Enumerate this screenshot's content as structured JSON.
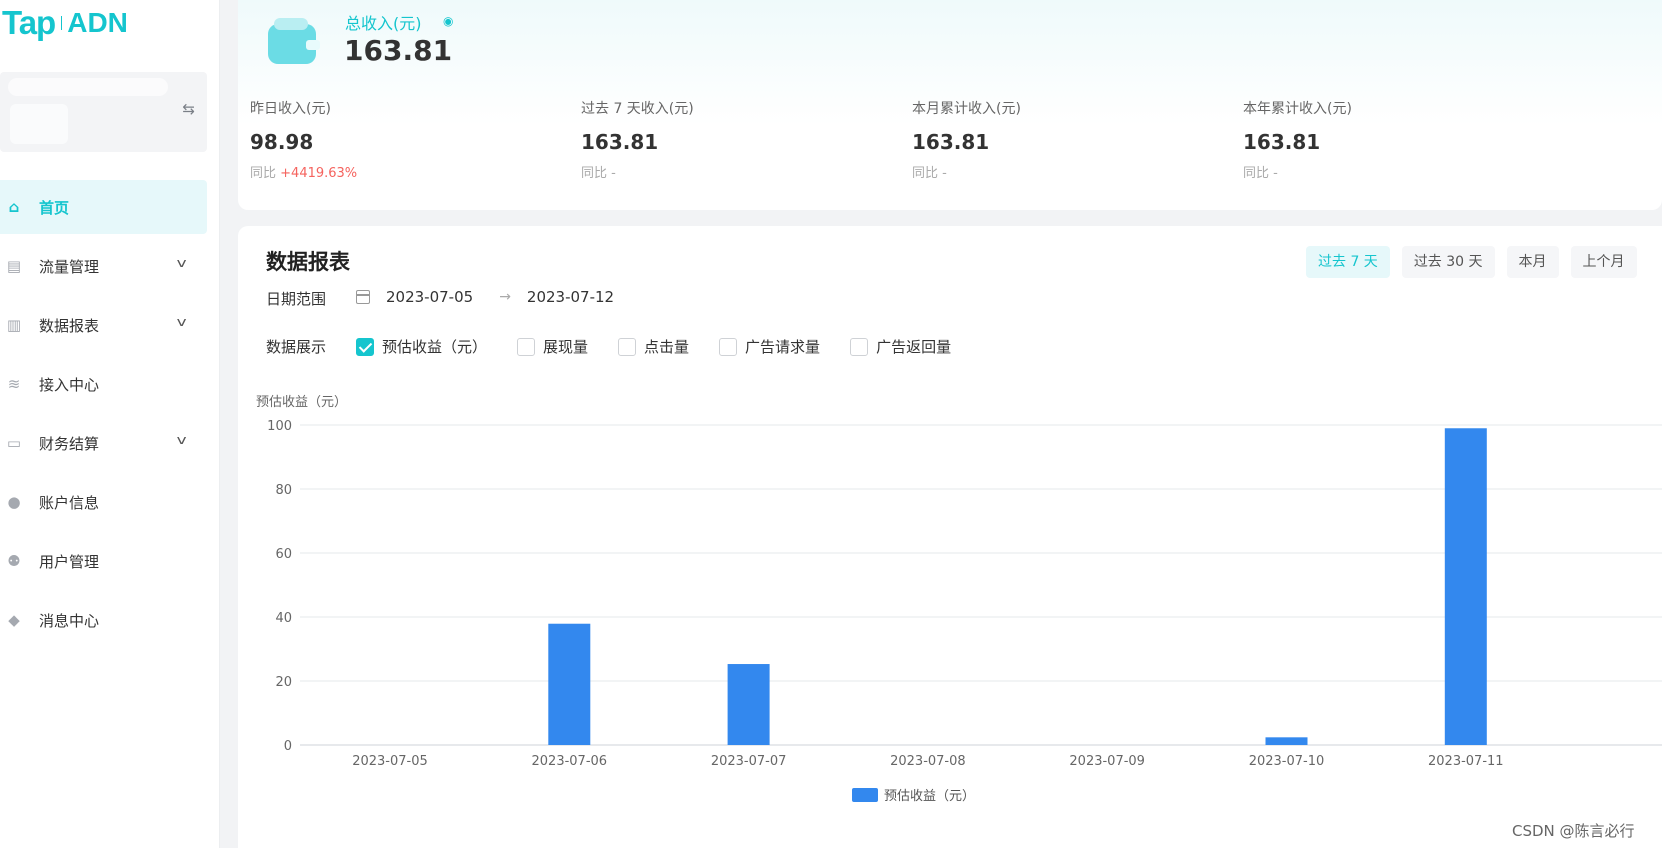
{
  "brand": {
    "tap": "Tap",
    "adn": "ADN"
  },
  "nav": [
    {
      "label": "首页",
      "icon": "home-icon",
      "active": true,
      "expandable": false
    },
    {
      "label": "流量管理",
      "icon": "traffic-icon",
      "active": false,
      "expandable": true
    },
    {
      "label": "数据报表",
      "icon": "report-icon",
      "active": false,
      "expandable": true
    },
    {
      "label": "接入中心",
      "icon": "layers-icon",
      "active": false,
      "expandable": false
    },
    {
      "label": "财务结算",
      "icon": "card-icon",
      "active": false,
      "expandable": true
    },
    {
      "label": "账户信息",
      "icon": "user-icon",
      "active": false,
      "expandable": false
    },
    {
      "label": "用户管理",
      "icon": "users-icon",
      "active": false,
      "expandable": false
    },
    {
      "label": "消息中心",
      "icon": "bell-icon",
      "active": false,
      "expandable": false
    }
  ],
  "revenue": {
    "total_label": "总收入(元)",
    "total_value": "163.81",
    "stats": [
      {
        "label": "昨日收入(元)",
        "value": "98.98",
        "cmp_prefix": "同比",
        "cmp_value": "+4419.63%"
      },
      {
        "label": "过去 7 天收入(元)",
        "value": "163.81",
        "cmp_prefix": "同比",
        "cmp_value": "-"
      },
      {
        "label": "本月累计收入(元)",
        "value": "163.81",
        "cmp_prefix": "同比",
        "cmp_value": "-"
      },
      {
        "label": "本年累计收入(元)",
        "value": "163.81",
        "cmp_prefix": "同比",
        "cmp_value": "-"
      }
    ]
  },
  "report": {
    "title": "数据报表",
    "range_tabs": [
      {
        "label": "过去 7 天",
        "active": true
      },
      {
        "label": "过去 30 天",
        "active": false
      },
      {
        "label": "本月",
        "active": false
      },
      {
        "label": "上个月",
        "active": false
      }
    ],
    "date_label": "日期范围",
    "date_start": "2023-07-05",
    "date_end": "2023-07-12",
    "display_label": "数据展示",
    "metrics": [
      {
        "label": "预估收益（元）",
        "checked": true
      },
      {
        "label": "展现量",
        "checked": false
      },
      {
        "label": "点击量",
        "checked": false
      },
      {
        "label": "广告请求量",
        "checked": false
      },
      {
        "label": "广告返回量",
        "checked": false
      }
    ]
  },
  "chart_data": {
    "type": "bar",
    "ylabel": "预估收益（元）",
    "categories": [
      "2023-07-05",
      "2023-07-06",
      "2023-07-07",
      "2023-07-08",
      "2023-07-09",
      "2023-07-10",
      "2023-07-11"
    ],
    "series": [
      {
        "name": "预估收益（元）",
        "values": [
          0,
          37.9,
          25.3,
          0,
          0,
          2.4,
          98.98
        ],
        "color": "#3388ee"
      }
    ],
    "ylim": [
      0,
      100
    ],
    "yticks": [
      0,
      20,
      40,
      60,
      80,
      100
    ],
    "grid": true,
    "legend": "bottom"
  },
  "colors": {
    "accent": "#15c5ce",
    "up": "#f5635e",
    "bar": "#3388ee"
  },
  "watermark": "CSDN @陈言必行"
}
